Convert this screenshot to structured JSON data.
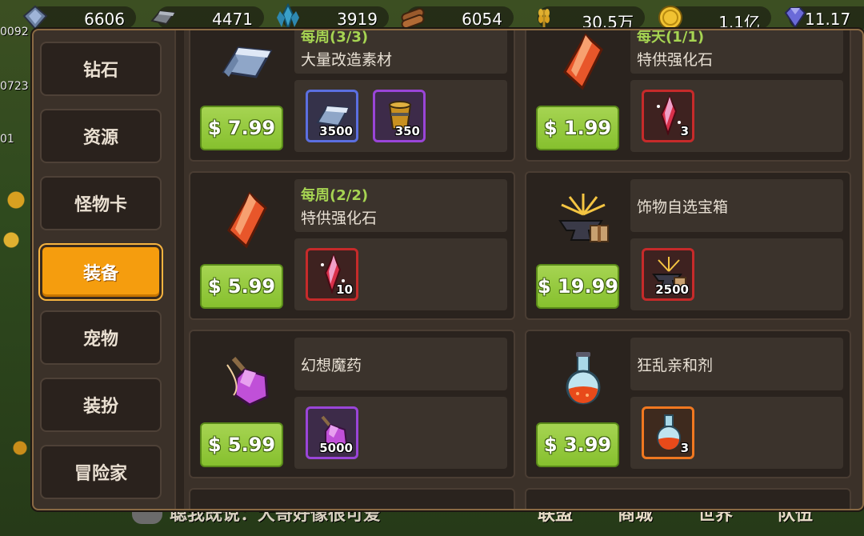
{
  "top_resources": [
    {
      "icon": "diamond-ore-icon",
      "value": "6606"
    },
    {
      "icon": "iron-ingot-icon",
      "value": "4471"
    },
    {
      "icon": "crystal-icon",
      "value": "3919"
    },
    {
      "icon": "wood-log-icon",
      "value": "6054"
    },
    {
      "icon": "wheat-icon",
      "value": "30.5万"
    },
    {
      "icon": "gold-coin-icon",
      "value": "1.1亿"
    },
    {
      "icon": "gem-icon",
      "value": "11.17"
    }
  ],
  "left_edge_numbers": [
    "0092",
    "0723",
    "01"
  ],
  "sidebar": {
    "items": [
      {
        "label": "钻石",
        "active": false
      },
      {
        "label": "资源",
        "active": false
      },
      {
        "label": "怪物卡",
        "active": false
      },
      {
        "label": "装备",
        "active": true
      },
      {
        "label": "宠物",
        "active": false
      },
      {
        "label": "装扮",
        "active": false
      },
      {
        "label": "冒险家",
        "active": false
      }
    ]
  },
  "shop_items": [
    {
      "limit": "每周(3/3)",
      "name": "大量改造素材",
      "price": "$ 7.99",
      "icon": "silver-ingot-icon",
      "rewards": [
        {
          "icon": "silver-ingot-icon",
          "count": "3500",
          "rarity": "blue"
        },
        {
          "icon": "bucket-icon",
          "count": "350",
          "rarity": "purple"
        }
      ]
    },
    {
      "limit": "每天(1/1)",
      "name": "特供强化石",
      "price": "$ 1.99",
      "icon": "orange-crystal-icon",
      "rewards": [
        {
          "icon": "enhance-crystal-icon",
          "count": "3",
          "rarity": "red"
        }
      ]
    },
    {
      "limit": "每周(2/2)",
      "name": "特供强化石",
      "price": "$ 5.99",
      "icon": "orange-crystal-icon",
      "rewards": [
        {
          "icon": "enhance-crystal-icon",
          "count": "10",
          "rarity": "red"
        }
      ]
    },
    {
      "limit": "",
      "name": "饰物自选宝箱",
      "price": "$ 19.99",
      "icon": "anvil-chest-icon",
      "rewards": [
        {
          "icon": "anvil-chest-icon",
          "count": "2500",
          "rarity": "red"
        }
      ]
    },
    {
      "limit": "",
      "name": "幻想魔药",
      "price": "$ 5.99",
      "icon": "purple-potion-icon",
      "rewards": [
        {
          "icon": "purple-potion-icon",
          "count": "5000",
          "rarity": "purple"
        }
      ]
    },
    {
      "limit": "",
      "name": "狂乱亲和剂",
      "price": "$ 3.99",
      "icon": "red-flask-icon",
      "rewards": [
        {
          "icon": "red-flask-icon",
          "count": "3",
          "rarity": "orange"
        }
      ]
    }
  ],
  "bottom_bar": {
    "chat_text": "聪我既说：大哥好像很可爱",
    "tabs": [
      "联盟",
      "商城",
      "世界",
      "队伍"
    ]
  }
}
